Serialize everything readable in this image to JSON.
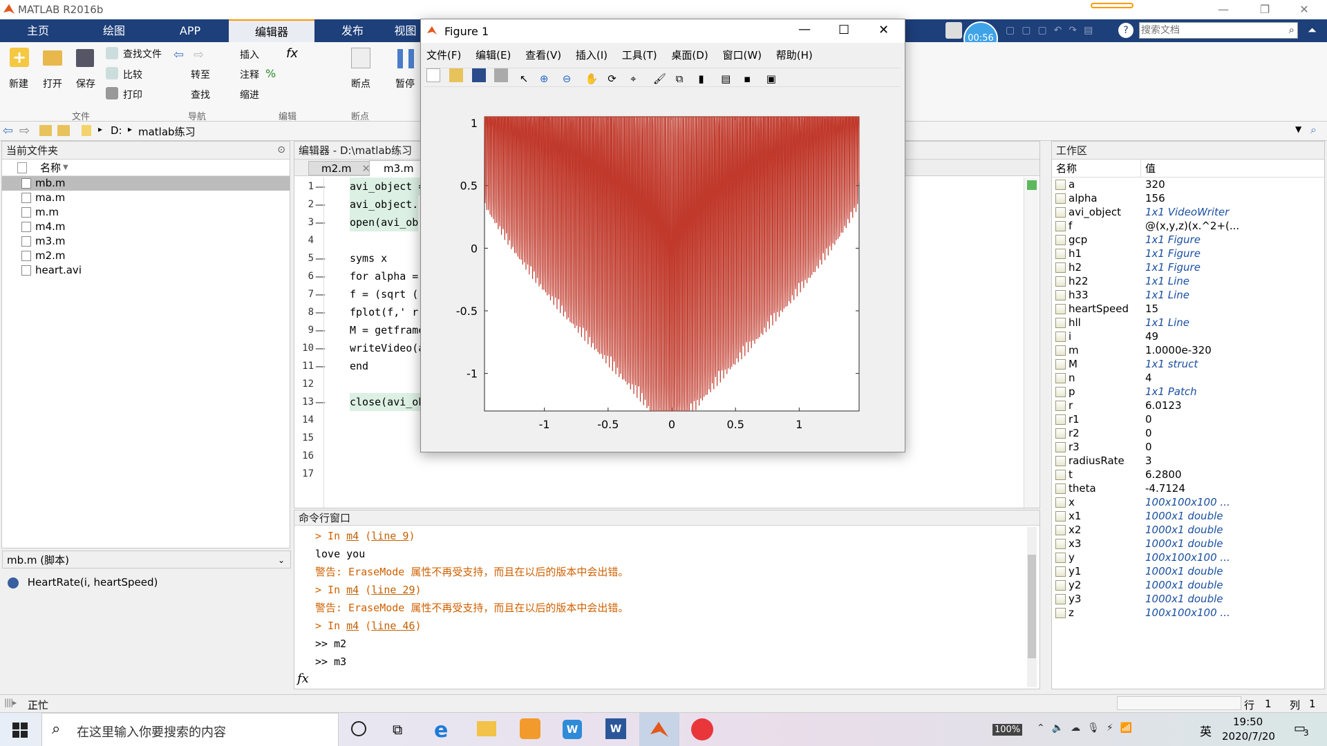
{
  "app": {
    "title": "MATLAB R2016b"
  },
  "tabs": [
    "主页",
    "绘图",
    "APP",
    "编辑器",
    "发布",
    "视图"
  ],
  "ribbon": {
    "buttons": {
      "new": "新建",
      "open": "打开",
      "save": "保存",
      "find_files": "查找文件",
      "compare": "比较",
      "print": "打印",
      "goto": "转至",
      "find": "查找",
      "insert": "插入",
      "comment": "注释",
      "indent": "缩进",
      "breakpoints": "断点",
      "pause": "暂停"
    },
    "groups": {
      "file": "文件",
      "nav": "导航",
      "edit": "编辑",
      "bp": "断点"
    }
  },
  "address": {
    "drive": "D:",
    "folder": "matlab练习",
    "sep": "▸"
  },
  "current_folder": {
    "title": "当前文件夹",
    "col": "名称",
    "files": [
      {
        "name": "mb.m",
        "sel": true
      },
      {
        "name": "ma.m"
      },
      {
        "name": "m.m"
      },
      {
        "name": "m4.m"
      },
      {
        "name": "m3.m"
      },
      {
        "name": "m2.m"
      },
      {
        "name": "heart.avi"
      }
    ],
    "details_title": "mb.m (脚本)",
    "details_item": "HeartRate(i, heartSpeed)"
  },
  "editor": {
    "title": "编辑器 - D:\\matlab练习",
    "tabs": [
      "m2.m",
      "m3.m"
    ],
    "lines": [
      {
        "n": "1",
        "d": "—",
        "t": "avi_object ="
      },
      {
        "n": "2",
        "d": "—",
        "t": "avi_object."
      },
      {
        "n": "3",
        "d": "—",
        "t": "open(avi_ob"
      },
      {
        "n": "4",
        "d": "",
        "t": ""
      },
      {
        "n": "5",
        "d": "—",
        "t": "syms x"
      },
      {
        "n": "6",
        "d": "—",
        "t": "for alpha ="
      },
      {
        "n": "7",
        "d": "—",
        "t": "f = (sqrt (("
      },
      {
        "n": "8",
        "d": "—",
        "t": "fplot(f,' r'"
      },
      {
        "n": "9",
        "d": "—",
        "t": "M = getframe"
      },
      {
        "n": "10",
        "d": "—",
        "t": "writeVideo(a"
      },
      {
        "n": "11",
        "d": "—",
        "t": "end"
      },
      {
        "n": "12",
        "d": "",
        "t": ""
      },
      {
        "n": "13",
        "d": "—",
        "t": "close(avi_ob"
      },
      {
        "n": "14",
        "d": "",
        "t": ""
      },
      {
        "n": "15",
        "d": "",
        "t": ""
      },
      {
        "n": "16",
        "d": "",
        "t": ""
      },
      {
        "n": "17",
        "d": "",
        "t": ""
      }
    ]
  },
  "command": {
    "title": "命令行窗口",
    "lines": [
      {
        "k": "in",
        "a": "> In ",
        "b": "m4",
        "c": " (",
        "d": "line 9",
        "e": ")"
      },
      {
        "k": "txt",
        "a": "love you"
      },
      {
        "k": "warn",
        "a": "警告: EraseMode 属性不再受支持，而且在以后的版本中会出错。"
      },
      {
        "k": "in",
        "a": "> In ",
        "b": "m4",
        "c": " (",
        "d": "line 29",
        "e": ")"
      },
      {
        "k": "warn",
        "a": "警告: EraseMode 属性不再受支持，而且在以后的版本中会出错。"
      },
      {
        "k": "in",
        "a": "> In ",
        "b": "m4",
        "c": " (",
        "d": "line 46",
        "e": ")"
      },
      {
        "k": "txt",
        "a": ">> m2"
      },
      {
        "k": "txt",
        "a": ">> m3"
      }
    ],
    "fx": "fx"
  },
  "workspace": {
    "title": "工作区",
    "col_name": "名称",
    "col_value": "值",
    "vars": [
      {
        "name": "a",
        "value": "320"
      },
      {
        "name": "alpha",
        "value": "156"
      },
      {
        "name": "avi_object",
        "value": "1x1 VideoWriter",
        "it": true
      },
      {
        "name": "f",
        "value": "@(x,y,z)(x.^2+(..."
      },
      {
        "name": "gcp",
        "value": "1x1 Figure",
        "it": true
      },
      {
        "name": "h1",
        "value": "1x1 Figure",
        "it": true
      },
      {
        "name": "h2",
        "value": "1x1 Figure",
        "it": true
      },
      {
        "name": "h22",
        "value": "1x1 Line",
        "it": true
      },
      {
        "name": "h33",
        "value": "1x1 Line",
        "it": true
      },
      {
        "name": "heartSpeed",
        "value": "15"
      },
      {
        "name": "hll",
        "value": "1x1 Line",
        "it": true
      },
      {
        "name": "i",
        "value": "49"
      },
      {
        "name": "m",
        "value": "1.0000e-320"
      },
      {
        "name": "M",
        "value": "1x1 struct",
        "it": true
      },
      {
        "name": "n",
        "value": "4"
      },
      {
        "name": "p",
        "value": "1x1 Patch",
        "it": true
      },
      {
        "name": "r",
        "value": "6.0123"
      },
      {
        "name": "r1",
        "value": "0"
      },
      {
        "name": "r2",
        "value": "0"
      },
      {
        "name": "r3",
        "value": "0"
      },
      {
        "name": "radiusRate",
        "value": "3"
      },
      {
        "name": "t",
        "value": "6.2800"
      },
      {
        "name": "theta",
        "value": "-4.7124"
      },
      {
        "name": "x",
        "value": "100x100x100 ...",
        "it": true
      },
      {
        "name": "x1",
        "value": "1000x1 double",
        "it": true
      },
      {
        "name": "x2",
        "value": "1000x1 double",
        "it": true
      },
      {
        "name": "x3",
        "value": "1000x1 double",
        "it": true
      },
      {
        "name": "y",
        "value": "100x100x100 ...",
        "it": true
      },
      {
        "name": "y1",
        "value": "1000x1 double",
        "it": true
      },
      {
        "name": "y2",
        "value": "1000x1 double",
        "it": true
      },
      {
        "name": "y3",
        "value": "1000x1 double",
        "it": true
      },
      {
        "name": "z",
        "value": "100x100x100 ...",
        "it": true
      }
    ]
  },
  "search": {
    "placeholder": "搜索文档"
  },
  "timer": "00:56",
  "status": {
    "busy": "正忙",
    "row_label": "行",
    "row": "1",
    "col_label": "列",
    "col": "1"
  },
  "figure": {
    "title": "Figure 1",
    "menu": [
      "文件(F)",
      "编辑(E)",
      "查看(V)",
      "插入(I)",
      "工具(T)",
      "桌面(D)",
      "窗口(W)",
      "帮助(H)"
    ]
  },
  "chart_data": {
    "type": "line",
    "title": "",
    "xlabel": "",
    "ylabel": "",
    "xlim": [
      -1.47,
      1.47
    ],
    "ylim": [
      -1.3,
      1.05
    ],
    "xticks": [
      "-1",
      "-0.5",
      "0",
      "0.5",
      "1"
    ],
    "xtick_values": [
      -1,
      -0.5,
      0,
      0.5,
      1
    ],
    "yticks": [
      "1",
      "0.5",
      "0",
      "-0.5",
      "-1"
    ],
    "ytick_values": [
      1,
      0.5,
      0,
      -0.5,
      -1
    ],
    "series": [
      {
        "function": "f(x) = x^(2/3) + 0.9*sqrt(3.3 - x^2)*sin(156*pi*x)",
        "color": "#c0392b",
        "alpha": 156
      }
    ]
  },
  "taskbar": {
    "search": "在这里输入你要搜索的内容",
    "time": "19:50",
    "date": "2020/7/20",
    "battery": "100%",
    "ime": "英",
    "notif": "3"
  },
  "colors": {
    "tabbar": "#1d3f7a",
    "accent": "#f90",
    "plot": "#c0392b"
  }
}
